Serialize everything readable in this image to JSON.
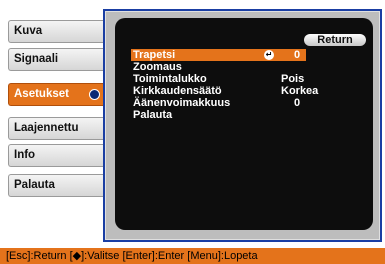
{
  "sidebar": {
    "items": [
      {
        "label": "Kuva"
      },
      {
        "label": "Signaali"
      },
      {
        "label": "Asetukset"
      },
      {
        "label": "Laajennettu"
      },
      {
        "label": "Info"
      },
      {
        "label": "Palauta"
      }
    ],
    "active_index": 2
  },
  "panel": {
    "return_label": "Return",
    "rows": [
      {
        "label": "Trapetsi",
        "value": "0"
      },
      {
        "label": "Zoomaus",
        "value": ""
      },
      {
        "label": "Toimintalukko",
        "value": "Pois"
      },
      {
        "label": "Kirkkaudensäätö",
        "value": "Korkea"
      },
      {
        "label": "Äänenvoimakkuus",
        "value": "0"
      },
      {
        "label": "Palauta",
        "value": ""
      }
    ]
  },
  "footer": {
    "text": "[Esc]:Return [◆]:Valitse [Enter]:Enter [Menu]:Lopeta"
  },
  "colors": {
    "accent": "#e4731b",
    "frame": "#1a3ea3",
    "panel_bg": "#0d0d0d"
  }
}
